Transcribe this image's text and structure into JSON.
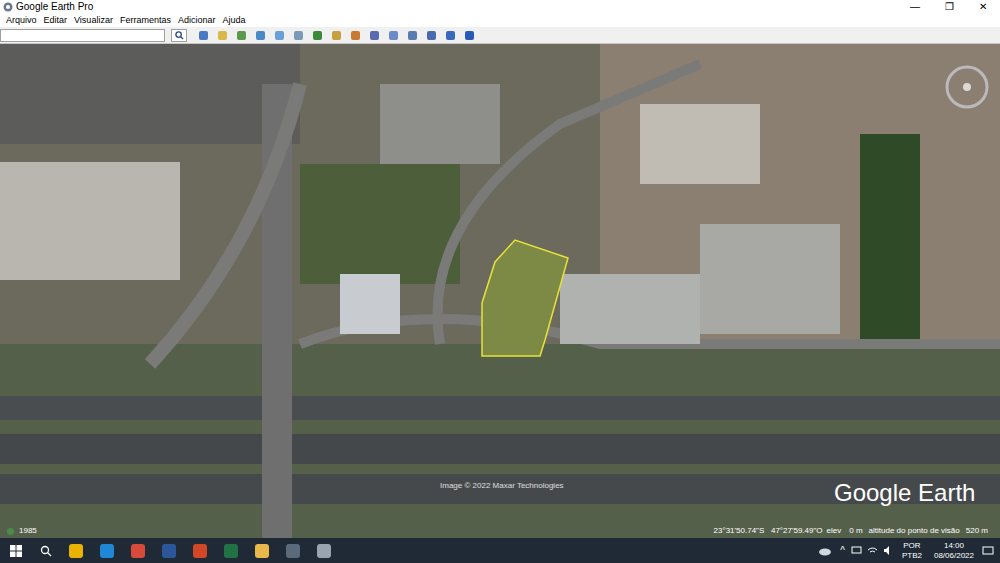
{
  "window": {
    "title": "Google Earth Pro",
    "controls": [
      "—",
      "❐",
      "✕"
    ]
  },
  "menu": [
    "Arquivo",
    "Editar",
    "Visualizar",
    "Ferramentas",
    "Adicionar",
    "Ajuda"
  ],
  "search": {
    "value": ""
  },
  "map": {
    "attribution": "Image © 2022 Maxar Technologies",
    "logo": "Google Earth",
    "year": "1985",
    "coordinates": "23°31'50.74\"S   47°27'59.49\"O",
    "elevation_label": "elev",
    "elevation": "0 m",
    "eye_alt_label": "altitude do ponto de visão",
    "eye_alt": "520 m"
  },
  "taskbar": {
    "language": "POR",
    "layout": "PTB2",
    "time": "14:00",
    "date": "08/06/2022",
    "tray_arrow": "^"
  }
}
